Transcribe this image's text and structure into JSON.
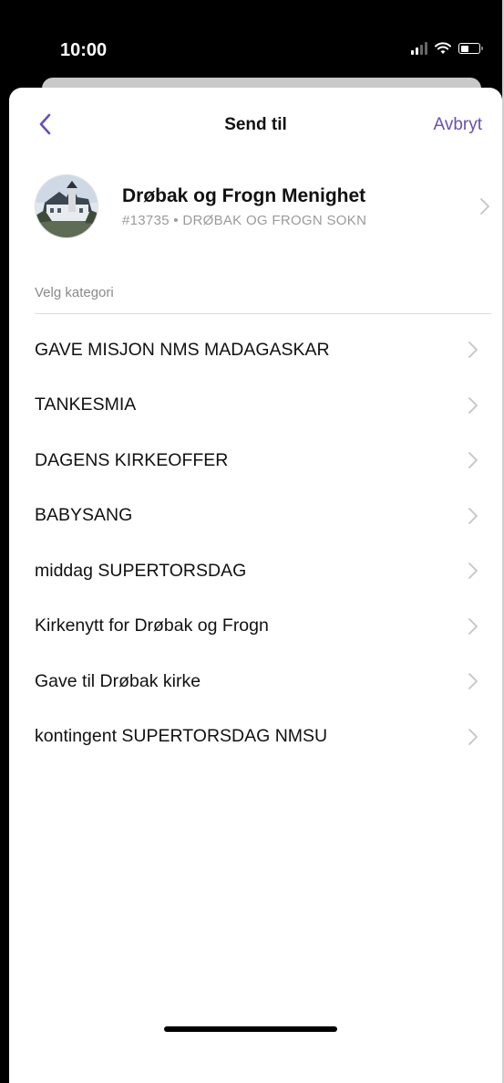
{
  "status": {
    "time": "10:00"
  },
  "nav": {
    "title": "Send til",
    "cancel": "Avbryt",
    "back_icon": "chevron-left-icon"
  },
  "recipient": {
    "name": "Drøbak og Frogn Menighet",
    "subtitle": "#13735 • DRØBAK OG FROGN SOKN"
  },
  "section": {
    "label": "Velg kategori"
  },
  "categories": [
    {
      "label": "GAVE MISJON NMS MADAGASKAR"
    },
    {
      "label": "TANKESMIA"
    },
    {
      "label": "DAGENS KIRKEOFFER"
    },
    {
      "label": "BABYSANG"
    },
    {
      "label": "middag SUPERTORSDAG"
    },
    {
      "label": "Kirkenytt for Drøbak og Frogn"
    },
    {
      "label": "Gave til Drøbak kirke"
    },
    {
      "label": "kontingent SUPERTORSDAG NMSU"
    }
  ],
  "colors": {
    "accent": "#6a4fb0",
    "chevron": "#c4c4c4",
    "secondary_text": "#9a9a9a"
  }
}
